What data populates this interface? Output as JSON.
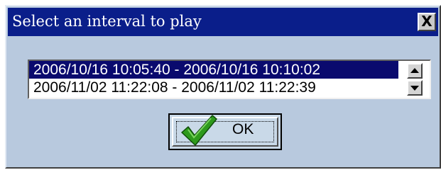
{
  "dialog": {
    "title": "Select an interval to play",
    "close_label": "X",
    "intervals": [
      {
        "label": "2006/10/16 10:05:40 - 2006/10/16 10:10:02",
        "selected": true
      },
      {
        "label": "2006/11/02 11:22:08 - 2006/11/02 11:22:39",
        "selected": false
      }
    ],
    "ok_label": "OK",
    "icons": {
      "close": "close-icon",
      "scroll_up": "scroll-up-arrow-icon",
      "scroll_down": "scroll-down-arrow-icon",
      "ok": "green-checkmark-icon"
    },
    "colors": {
      "titlebar": "#0a1e8a",
      "body": "#b8c9de",
      "selection": "#0a0a6e",
      "checkmark": "#2e9a1c"
    }
  }
}
